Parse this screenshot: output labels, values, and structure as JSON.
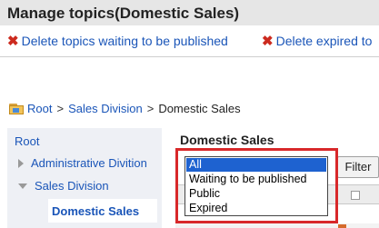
{
  "header": {
    "title": "Manage topics(Domestic Sales)"
  },
  "actions": [
    {
      "icon": "close-icon",
      "label": "Delete topics waiting to be published"
    },
    {
      "icon": "close-icon",
      "label": "Delete expired to"
    }
  ],
  "breadcrumb": {
    "icon": "folder-icon",
    "items": [
      "Root",
      "Sales Division",
      "Domestic Sales"
    ],
    "separator": ">"
  },
  "tree": {
    "root": "Root",
    "items": [
      {
        "label": "Administrative Divition",
        "state": "collapsed"
      },
      {
        "label": "Sales Division",
        "state": "expanded"
      },
      {
        "label": "Domestic Sales",
        "state": "selected"
      }
    ]
  },
  "main": {
    "title": "Domestic Sales",
    "status_filter": {
      "options": [
        "All",
        "Waiting to be published",
        "Public",
        "Expired"
      ],
      "selected": "All"
    },
    "filter_button": "Filter"
  },
  "colors": {
    "link": "#1a55b8",
    "delete_icon": "#cc2a1e",
    "highlight": "#d8282a",
    "selected_option": "#1e62d0",
    "tree_background": "#eef0f5"
  }
}
